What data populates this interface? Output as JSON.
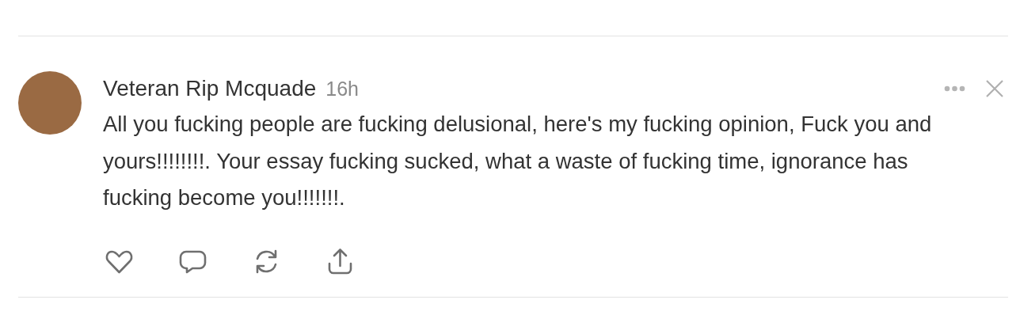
{
  "comment": {
    "author": "Veteran Rip Mcquade",
    "time": "16h",
    "body": "All you fucking people are fucking delusional, here's my fucking opinion, Fuck you and yours!!!!!!!!. Your essay fucking sucked, what a waste of fucking time, ignorance has fucking become you!!!!!!!."
  }
}
